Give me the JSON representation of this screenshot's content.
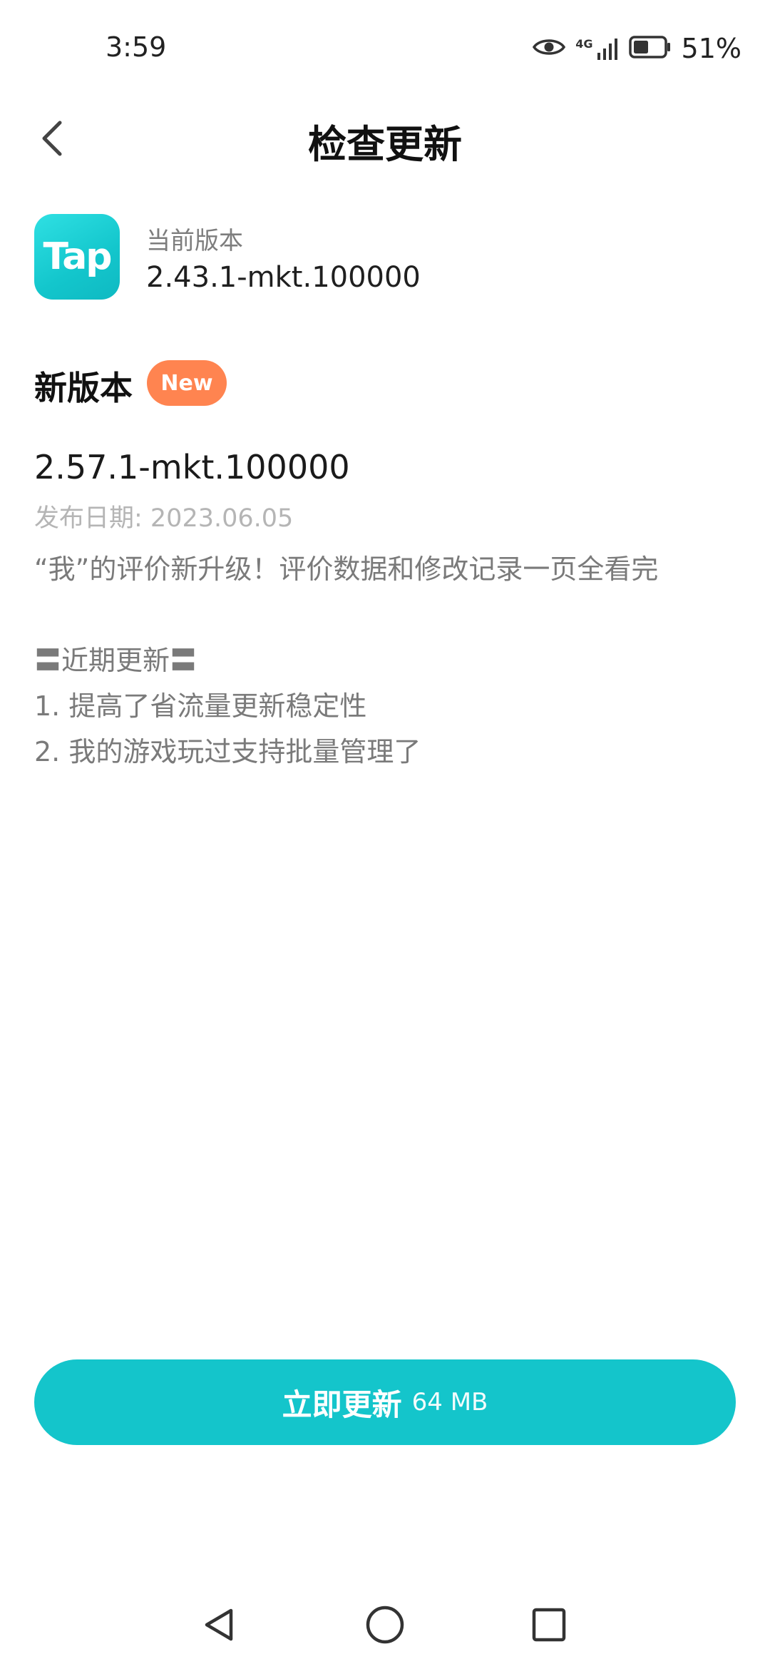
{
  "status_bar": {
    "time": "3:59",
    "network": "4G",
    "battery_percent": "51%",
    "battery_level": 0.51
  },
  "header": {
    "title": "检查更新"
  },
  "current": {
    "app_icon_text": "Tap",
    "label": "当前版本",
    "version": "2.43.1-mkt.100000"
  },
  "new_version": {
    "heading": "新版本",
    "badge": "New",
    "version": "2.57.1-mkt.100000",
    "release_date": "发布日期: 2023.06.05",
    "notes": [
      "“我”的评价新升级！评价数据和修改记录一页全看完",
      "",
      "〓近期更新〓",
      "1. 提高了省流量更新稳定性",
      "2. 我的游戏玩过支持批量管理了"
    ]
  },
  "update_button": {
    "label": "立即更新",
    "size": "64 MB"
  },
  "colors": {
    "accent": "#14c5cb",
    "badge": "#ff8450"
  }
}
